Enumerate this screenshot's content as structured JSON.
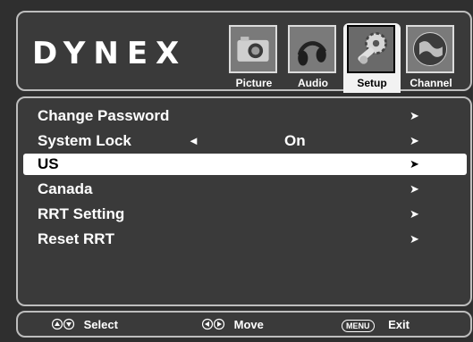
{
  "brand": "DYNEX",
  "tabs": [
    {
      "label": "Picture",
      "icon": "camera-icon",
      "active": false
    },
    {
      "label": "Audio",
      "icon": "headphones-icon",
      "active": false
    },
    {
      "label": "Setup",
      "icon": "gears-icon",
      "active": true
    },
    {
      "label": "Channel",
      "icon": "globe-icon",
      "active": false
    }
  ],
  "menu": {
    "items": [
      {
        "label": "Change Password",
        "value": "",
        "arrow": "➤"
      },
      {
        "label": "System Lock",
        "value": "On",
        "left_arrow": "◄",
        "arrow": "➤"
      },
      {
        "label": "US",
        "value": "",
        "arrow": "➤",
        "selected": true
      },
      {
        "label": "Canada",
        "value": "",
        "arrow": "➤"
      },
      {
        "label": "RRT Setting",
        "value": "",
        "arrow": "➤"
      },
      {
        "label": "Reset RRT",
        "value": "",
        "arrow": "➤"
      }
    ]
  },
  "footer": {
    "select_label": "Select",
    "move_label": "Move",
    "menu_badge": "MENU",
    "exit_label": "Exit"
  }
}
